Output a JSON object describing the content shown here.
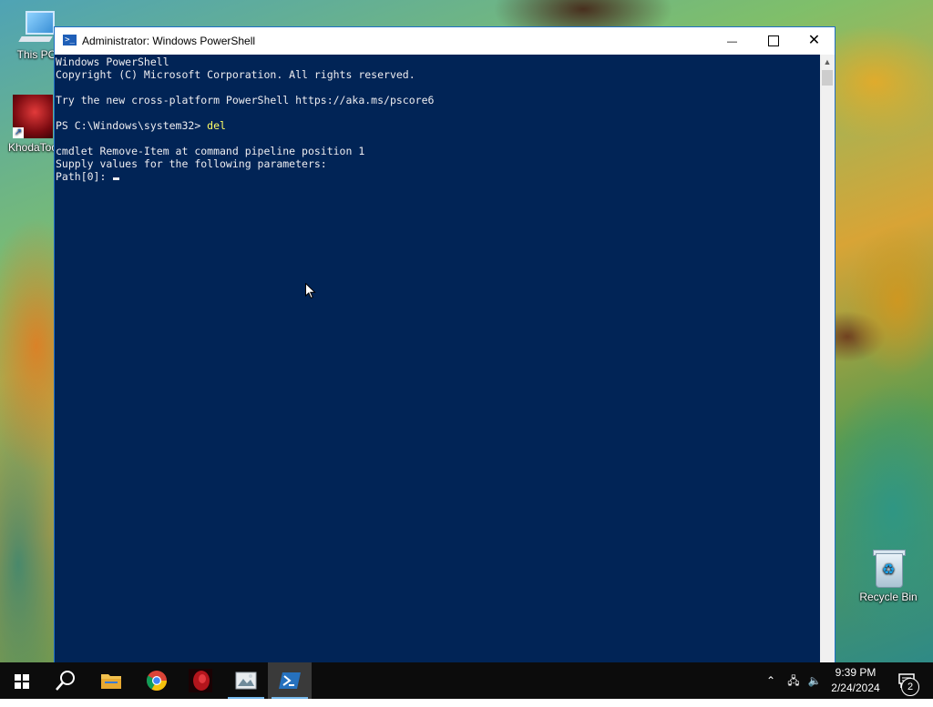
{
  "desktop": {
    "icons": [
      {
        "label": "This PC"
      },
      {
        "label": "KhodaToo"
      },
      {
        "label": "Recycle Bin"
      }
    ]
  },
  "window": {
    "title": "Administrator: Windows PowerShell",
    "controls": {
      "minimize": "—",
      "close": "✕"
    }
  },
  "console": {
    "lines": [
      "Windows PowerShell",
      "Copyright (C) Microsoft Corporation. All rights reserved.",
      "",
      "Try the new cross-platform PowerShell https://aka.ms/pscore6",
      "",
      "PS C:\\Windows\\system32> ",
      "",
      "cmdlet Remove-Item at command pipeline position 1",
      "Supply values for the following parameters:",
      "Path[0]: "
    ],
    "typed_command": "del"
  },
  "taskbar": {
    "apps": [
      {
        "name": "search"
      },
      {
        "name": "file-explorer"
      },
      {
        "name": "chrome"
      },
      {
        "name": "khodatoo"
      },
      {
        "name": "image-tool"
      },
      {
        "name": "powershell",
        "active": true
      }
    ],
    "tray": {
      "up_arrow": "⌃",
      "network": "🖧",
      "volume": "🔈"
    },
    "clock": {
      "time": "9:39 PM",
      "date": "2/24/2024"
    },
    "notifications": "2"
  },
  "colors": {
    "console_bg": "#012456",
    "console_fg": "#eeedf0",
    "command_yellow": "#ffff66",
    "taskbar_bg": "#0c0c0c"
  }
}
